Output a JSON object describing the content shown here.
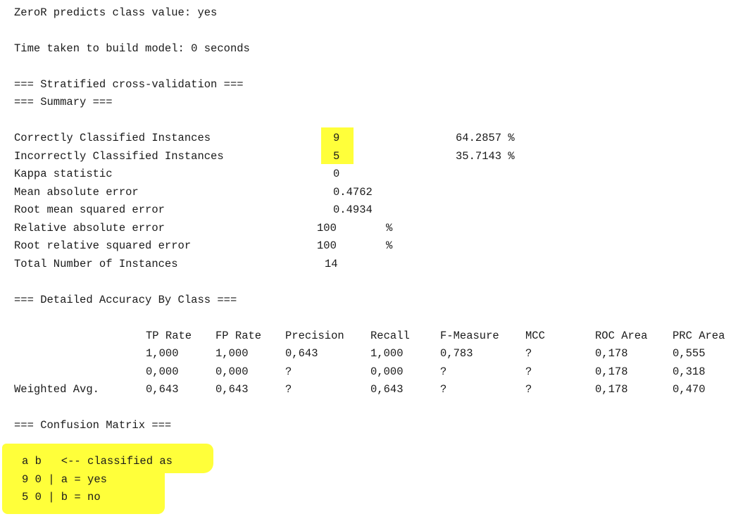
{
  "header": {
    "predicts": "ZeroR predicts class value: yes",
    "time": "Time taken to build model: 0 seconds",
    "cv_title": "=== Stratified cross-validation ===",
    "summary_title": "=== Summary ==="
  },
  "summary": {
    "correct_label": "Correctly Classified Instances",
    "correct_value": "9",
    "correct_pct": "64.2857 %",
    "incorrect_label": "Incorrectly Classified Instances",
    "incorrect_value": "5",
    "incorrect_pct": "35.7143 %",
    "kappa_label": "Kappa statistic",
    "kappa_value": "0",
    "mae_label": "Mean absolute error",
    "mae_value": "0.4762",
    "rmse_label": "Root mean squared error",
    "rmse_value": "0.4934",
    "rae_label": "Relative absolute error",
    "rae_value": "100",
    "rae_unit": "%",
    "rrse_label": "Root relative squared error",
    "rrse_value": "100",
    "rrse_unit": "%",
    "total_label": "Total Number of Instances",
    "total_value": "14"
  },
  "accuracy": {
    "title": "=== Detailed Accuracy By Class ===",
    "headers": [
      "TP Rate",
      "FP Rate",
      "Precision",
      "Recall",
      "F-Measure",
      "MCC",
      "ROC Area",
      "PRC Area"
    ],
    "rows": [
      {
        "label": "",
        "cells": [
          "1,000",
          "1,000",
          "0,643",
          "1,000",
          "0,783",
          "?",
          "0,178",
          "0,555"
        ]
      },
      {
        "label": "",
        "cells": [
          "0,000",
          "0,000",
          "?",
          "0,000",
          "?",
          "?",
          "0,178",
          "0,318"
        ]
      },
      {
        "label": "Weighted Avg.",
        "cells": [
          "0,643",
          "0,643",
          "?",
          "0,643",
          "?",
          "?",
          "0,178",
          "0,470"
        ]
      }
    ]
  },
  "confusion": {
    "title": "=== Confusion Matrix ===",
    "header": "a b   <-- classified as",
    "row_a": "9 0 | a = yes",
    "row_b": "5 0 | b = no"
  },
  "highlight_color": "#ffff3a"
}
